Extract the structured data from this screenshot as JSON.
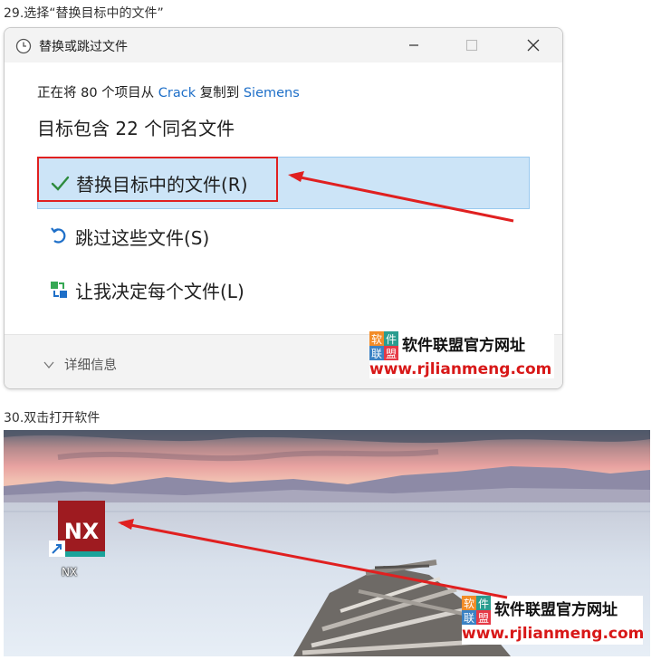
{
  "steps": {
    "step29": "29.选择“替换目标中的文件”",
    "step30": "30.双击打开软件"
  },
  "dialog": {
    "title": "替换或跳过文件",
    "info_prefix": "正在将 80 个项目从 ",
    "source": "Crack",
    "info_middle": " 复制到 ",
    "destination": "Siemens",
    "headline": "目标包含 22 个同名文件",
    "options": [
      {
        "label": "替换目标中的文件(R)",
        "icon": "check-icon",
        "selected": true
      },
      {
        "label": "跳过这些文件(S)",
        "icon": "skip-icon",
        "selected": false
      },
      {
        "label": "让我决定每个文件(L)",
        "icon": "decide-icon",
        "selected": false
      }
    ],
    "details_label": "详细信息",
    "window_buttons": [
      "minimize-icon",
      "maximize-icon",
      "close-icon"
    ]
  },
  "watermark": {
    "logo_chars": [
      "软",
      "件",
      "联",
      "盟"
    ],
    "title": "软件联盟官方网址",
    "url": "www.rjlianmeng.com"
  },
  "desktop": {
    "icon_text": "NX",
    "icon_label": "NX"
  },
  "colors": {
    "selection": "#cce4f7",
    "link": "#1e6fc8",
    "annotation": "#e02020",
    "nx_red": "#9e1b20",
    "nx_teal": "#1aa39a"
  }
}
